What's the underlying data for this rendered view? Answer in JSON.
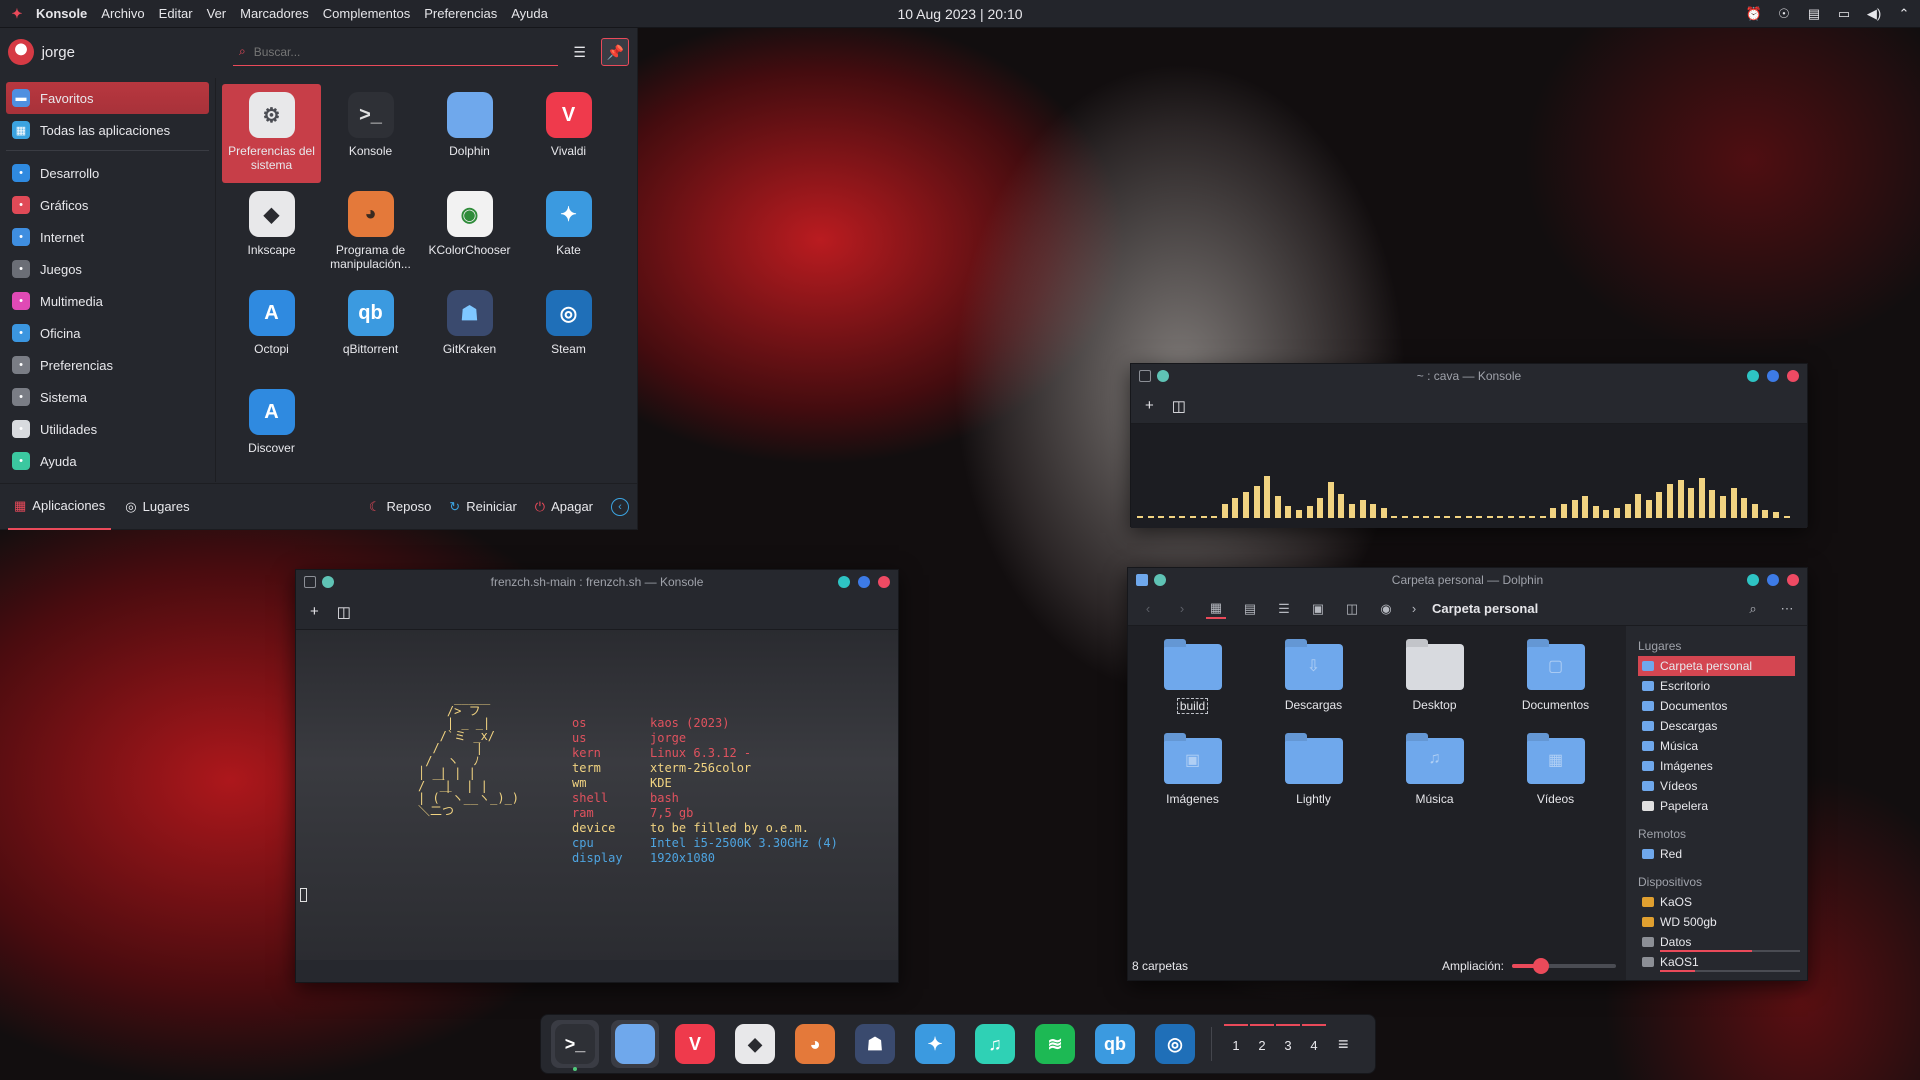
{
  "panel": {
    "app_name": "Konsole",
    "menu": [
      "Archivo",
      "Editar",
      "Ver",
      "Marcadores",
      "Complementos",
      "Preferencias",
      "Ayuda"
    ],
    "clock": "10 Aug 2023 | 20:10",
    "tray_icons": [
      "notifications-icon",
      "power-icon",
      "clipboard-icon",
      "display-icon",
      "volume-icon",
      "collapse-arrow-icon"
    ]
  },
  "launcher": {
    "username": "jorge",
    "search_placeholder": "Buscar...",
    "categories_top": [
      {
        "label": "Favoritos",
        "icon": "folder-icon",
        "color": "#4f8fe0"
      },
      {
        "label": "Todas las aplicaciones",
        "icon": "grid-icon",
        "color": "#3ba3e0"
      }
    ],
    "categories": [
      {
        "label": "Desarrollo",
        "icon": "dev-icon",
        "color": "#2f8ae0"
      },
      {
        "label": "Gráficos",
        "icon": "graphics-icon",
        "color": "#e04a57"
      },
      {
        "label": "Internet",
        "icon": "internet-icon",
        "color": "#3f8ee0"
      },
      {
        "label": "Juegos",
        "icon": "gamepad-icon",
        "color": "#6b6e76"
      },
      {
        "label": "Multimedia",
        "icon": "multimedia-icon",
        "color": "#e04ab5"
      },
      {
        "label": "Oficina",
        "icon": "office-icon",
        "color": "#3b96e0"
      },
      {
        "label": "Preferencias",
        "icon": "preferences-icon",
        "color": "#7a7d85"
      },
      {
        "label": "Sistema",
        "icon": "system-icon",
        "color": "#7a7d85"
      },
      {
        "label": "Utilidades",
        "icon": "utilities-icon",
        "color": "#d8dade"
      },
      {
        "label": "Ayuda",
        "icon": "help-icon",
        "color": "#3bc8a0"
      }
    ],
    "apps": [
      {
        "label": "Preferencias del sistema",
        "glyph": "⚙",
        "color": "#e8e8ea",
        "fg": "#4a4c53"
      },
      {
        "label": "Konsole",
        "glyph": ">_",
        "color": "#2e3036",
        "fg": "#e0e0e0"
      },
      {
        "label": "Dolphin",
        "glyph": "",
        "color": "#6fa8ec",
        "fg": "#ffffff"
      },
      {
        "label": "Vivaldi",
        "glyph": "V",
        "color": "#ef3a4c",
        "fg": "#ffffff"
      },
      {
        "label": "Inkscape",
        "glyph": "◆",
        "color": "#e8e8ea",
        "fg": "#2a2b30"
      },
      {
        "label": "Programa de manipulación...",
        "glyph": "◕",
        "color": "#e4793a",
        "fg": "#3a2a20"
      },
      {
        "label": "KColorChooser",
        "glyph": "◉",
        "color": "#f2f2f2",
        "fg": "#2f8c3a"
      },
      {
        "label": "Kate",
        "glyph": "✦",
        "color": "#3b9ae0",
        "fg": "#ffffff"
      },
      {
        "label": "Octopi",
        "glyph": "A",
        "color": "#2f8ae0",
        "fg": "#ffffff"
      },
      {
        "label": "qBittorrent",
        "glyph": "qb",
        "color": "#3b9ae0",
        "fg": "#ffffff"
      },
      {
        "label": "GitKraken",
        "glyph": "☗",
        "color": "#3a4a6e",
        "fg": "#7fc7ff"
      },
      {
        "label": "Steam",
        "glyph": "◎",
        "color": "#1f6fb8",
        "fg": "#ffffff"
      },
      {
        "label": "Discover",
        "glyph": "A",
        "color": "#2f8ae0",
        "fg": "#ffffff"
      }
    ],
    "footer": {
      "tab_apps": "Aplicaciones",
      "tab_places": "Lugares",
      "sleep": "Reposo",
      "restart": "Reiniciar",
      "shutdown": "Apagar"
    }
  },
  "cava_window": {
    "title": "~ : cava — Konsole"
  },
  "konsole_window": {
    "title": "frenzch.sh-main : frenzch.sh — Konsole",
    "ascii_art": "     _____\n    /> フ\n    | _ _|\n   /`ミ _x/\n  /     |\n /  ヽ  ﾉ\n│  | | |\n/ ￣|  | |\n| (￣ヽ__ヽ_)_)\n＼二つ",
    "fetch": [
      {
        "key": "os",
        "value": "kaos (2023)"
      },
      {
        "key": "us",
        "value": "jorge"
      },
      {
        "key": "kern",
        "value": "Linux 6.3.12 -"
      },
      {
        "key": "term",
        "value": "xterm-256color"
      },
      {
        "key": "wm",
        "value": "KDE"
      },
      {
        "key": "shell",
        "value": "bash"
      },
      {
        "key": "ram",
        "value": "7,5 gb"
      },
      {
        "key": "device",
        "value": "to be filled by o.e.m."
      },
      {
        "key": "cpu",
        "value": "Intel i5-2500K 3.30GHz (4)"
      },
      {
        "key": "display",
        "value": "1920x1080"
      }
    ]
  },
  "dolphin_window": {
    "title": "Carpeta personal — Dolphin",
    "breadcrumb": "Carpeta personal",
    "folders": [
      {
        "label": "build",
        "emblem": "",
        "color": "#6fa8ec"
      },
      {
        "label": "Descargas",
        "emblem": "⇩",
        "color": "#6fa8ec"
      },
      {
        "label": "Desktop",
        "emblem": "",
        "color": "#d8dadf"
      },
      {
        "label": "Documentos",
        "emblem": "▢",
        "color": "#6fa8ec"
      },
      {
        "label": "Imágenes",
        "emblem": "▣",
        "color": "#6fa8ec"
      },
      {
        "label": "Lightly",
        "emblem": "",
        "color": "#6fa8ec"
      },
      {
        "label": "Música",
        "emblem": "♫",
        "color": "#6fa8ec"
      },
      {
        "label": "Vídeos",
        "emblem": "▦",
        "color": "#6fa8ec"
      }
    ],
    "status": "8 carpetas",
    "zoom_label": "Ampliación:",
    "zoom_level": 0.28,
    "places_head": "Lugares",
    "places": [
      "Carpeta personal",
      "Escritorio",
      "Documentos",
      "Descargas",
      "Música",
      "Imágenes",
      "Vídeos",
      "Papelera"
    ],
    "remote_head": "Remotos",
    "remote": [
      "Red"
    ],
    "devices_head": "Dispositivos",
    "devices": [
      {
        "label": "KaOS",
        "usage": null
      },
      {
        "label": "WD 500gb",
        "usage": null
      },
      {
        "label": "Datos",
        "usage": 0.66
      },
      {
        "label": "KaOS1",
        "usage": 0.25
      }
    ]
  },
  "dock": {
    "apps": [
      {
        "name": "konsole",
        "glyph": ">_",
        "color": "#2e3036"
      },
      {
        "name": "dolphin",
        "glyph": "",
        "color": "#6fa8ec"
      },
      {
        "name": "vivaldi",
        "glyph": "V",
        "color": "#ef3a4c"
      },
      {
        "name": "inkscape",
        "glyph": "◆",
        "color": "#e8e8ea"
      },
      {
        "name": "gimp",
        "glyph": "◕",
        "color": "#e4793a"
      },
      {
        "name": "gitkraken",
        "glyph": "☗",
        "color": "#3a4a6e"
      },
      {
        "name": "kate",
        "glyph": "✦",
        "color": "#3b9ae0"
      },
      {
        "name": "music",
        "glyph": "♫",
        "color": "#2fd1b5"
      },
      {
        "name": "spotify",
        "glyph": "≋",
        "color": "#1db954"
      },
      {
        "name": "qbittorrent",
        "glyph": "qb",
        "color": "#3b9ae0"
      },
      {
        "name": "steam",
        "glyph": "◎",
        "color": "#1f6fb8"
      }
    ],
    "desktops": [
      "1",
      "2",
      "3",
      "4"
    ]
  },
  "colors": {
    "accent": "#ea4a5a",
    "cava": "#f1d381",
    "fetch_key_red": "#e0525e",
    "fetch_key_yellow": "#f1d381",
    "fetch_key_blue": "#4ea4e0"
  }
}
